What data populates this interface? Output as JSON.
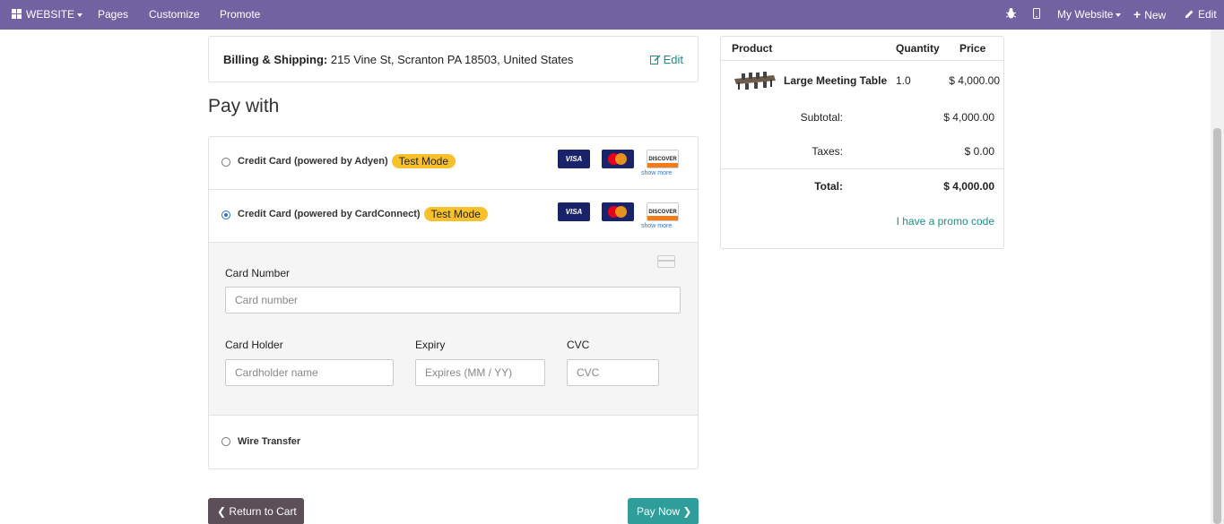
{
  "navbar": {
    "website_label": "WEBSITE",
    "pages": "Pages",
    "customize": "Customize",
    "promote": "Promote",
    "my_website": "My Website",
    "new": "New",
    "edit": "Edit",
    "bg_color": "#7262a2"
  },
  "billing": {
    "label": "Billing & Shipping:",
    "address": "215 Vine St, Scranton PA 18503, United States",
    "edit": "Edit"
  },
  "pay_with": {
    "title": "Pay with",
    "options": [
      {
        "label": "Credit Card (powered by Adyen)",
        "badge": "Test Mode",
        "selected": false,
        "cards": [
          "VISA",
          "MasterCard",
          "DISCOVER"
        ],
        "show_more": "show more"
      },
      {
        "label": "Credit Card (powered by CardConnect)",
        "badge": "Test Mode",
        "selected": true,
        "cards": [
          "VISA",
          "MasterCard",
          "DISCOVER"
        ],
        "show_more": "show more"
      },
      {
        "label": "Wire Transfer",
        "selected": false
      }
    ],
    "form": {
      "card_number_label": "Card Number",
      "card_number_placeholder": "Card number",
      "card_holder_label": "Card Holder",
      "card_holder_placeholder": "Cardholder name",
      "expiry_label": "Expiry",
      "expiry_placeholder": "Expires (MM / YY)",
      "cvc_label": "CVC",
      "cvc_placeholder": "CVC"
    }
  },
  "buttons": {
    "return_to_cart": "Return to Cart",
    "pay_now": "Pay Now"
  },
  "summary": {
    "headers": {
      "product": "Product",
      "quantity": "Quantity",
      "price": "Price"
    },
    "line": {
      "name": "Large Meeting Table",
      "quantity": "1.0",
      "price": "$ 4,000.00"
    },
    "subtotal_label": "Subtotal:",
    "subtotal": "$ 4,000.00",
    "taxes_label": "Taxes:",
    "taxes": "$ 0.00",
    "total_label": "Total:",
    "total": "$ 4,000.00",
    "promo": "I have a promo code"
  },
  "colors": {
    "accent": "#1d8f87",
    "badge": "#f8c12b",
    "pay_button": "#2f9e9a",
    "back_button": "#5c4f57"
  }
}
